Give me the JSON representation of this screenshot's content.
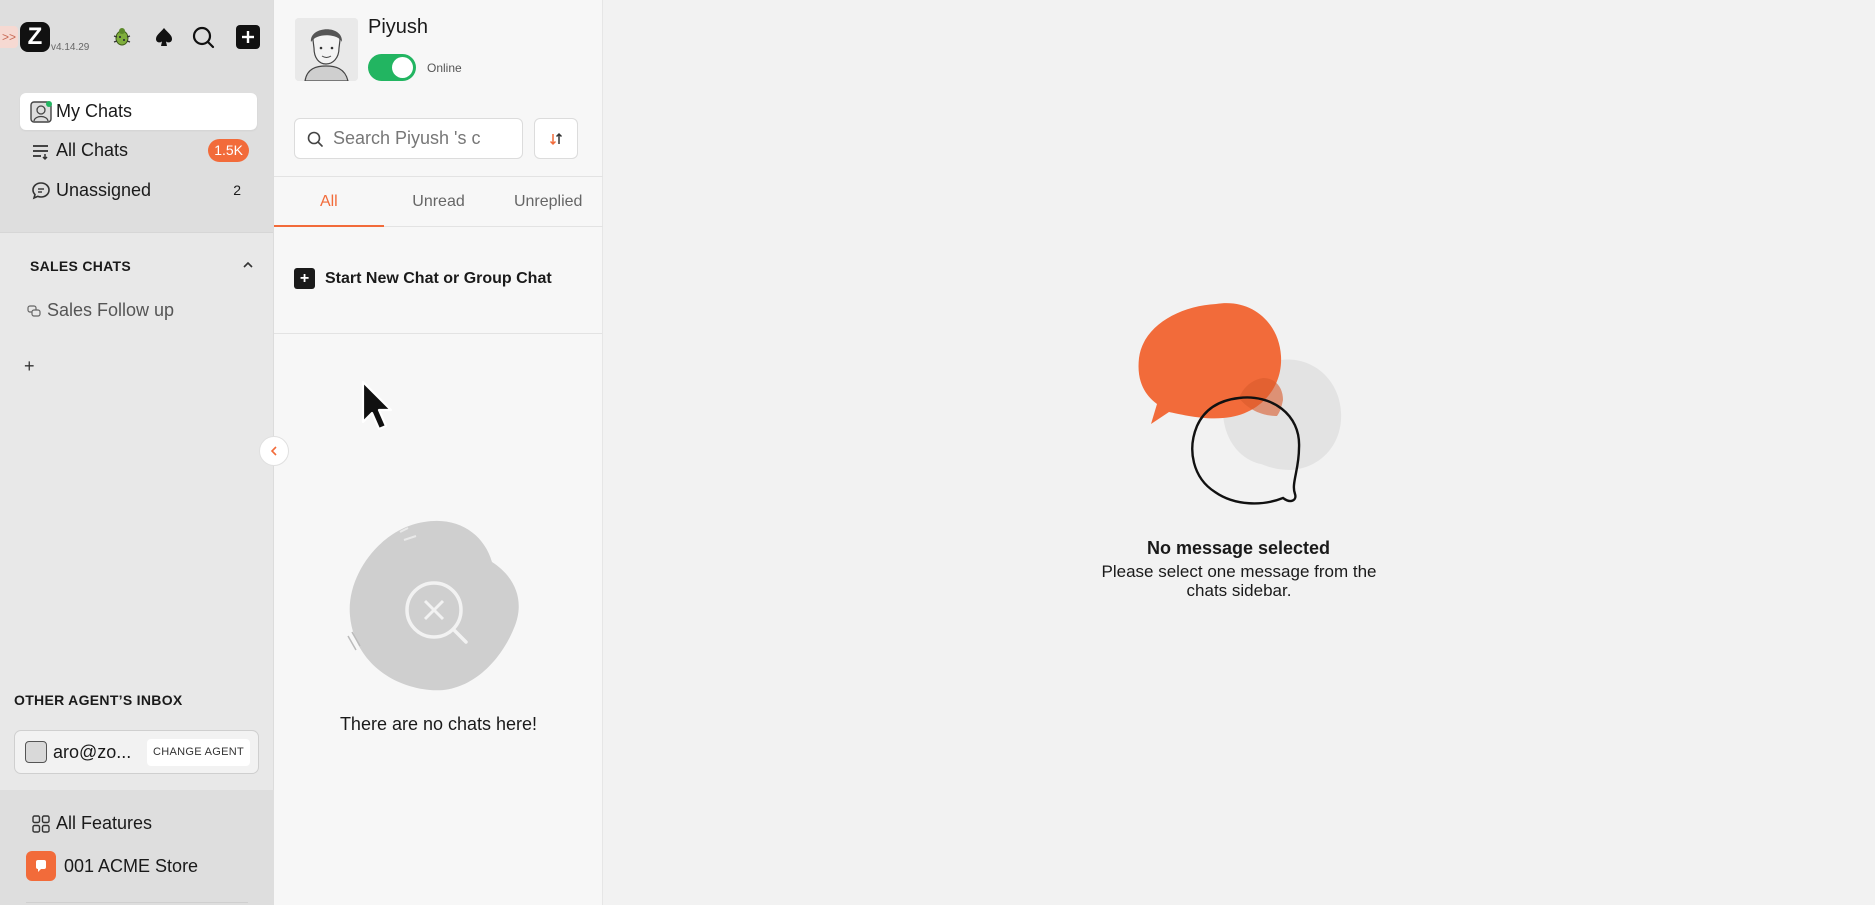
{
  "nav": {
    "version": "v4.14.29",
    "logo_letter": "Z",
    "expand_glyph": ">>",
    "items": [
      {
        "label": "My Chats",
        "active": true
      },
      {
        "label": "All Chats",
        "badge": "1.5K"
      },
      {
        "label": "Unassigned",
        "count": "2"
      }
    ],
    "sales_section": {
      "title": "SALES CHATS",
      "items": [
        {
          "label": "Sales Follow up"
        }
      ],
      "add_glyph": "+"
    },
    "other_agent": {
      "title": "OTHER AGENT’S INBOX",
      "email": "aro@zo...",
      "change_label": "CHANGE AGENT"
    },
    "bottom": {
      "features_label": "All Features",
      "store_label": "001 ACME Store"
    }
  },
  "chatlist": {
    "profile_name": "Piyush",
    "status": "Online",
    "search_placeholder": "Search Piyush 's c",
    "tabs": [
      "All",
      "Unread",
      "Unreplied"
    ],
    "new_chat_label": "Start New Chat or Group Chat",
    "empty_text": "There are no chats here!"
  },
  "main": {
    "title": "No message selected",
    "subtitle": "Please select one message from the chats sidebar."
  },
  "colors": {
    "accent": "#f26b3a",
    "online": "#22b561"
  }
}
